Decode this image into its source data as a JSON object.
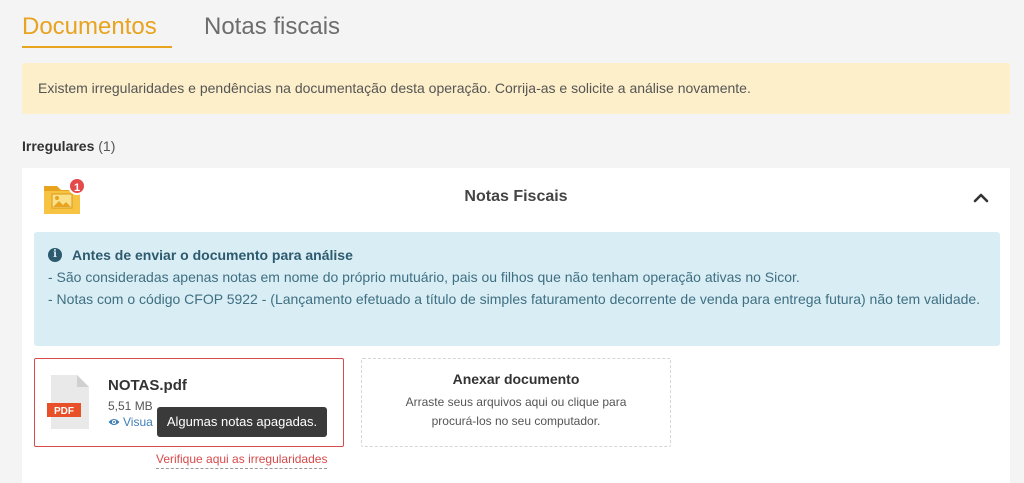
{
  "tabs": [
    {
      "label": "Documentos",
      "active": true
    },
    {
      "label": "Notas fiscais",
      "active": false
    }
  ],
  "warning": {
    "text": "Existem irregularidades e pendências na documentação desta operação. Corrija-as e solicite a análise novamente."
  },
  "section": {
    "title": "Irregulares",
    "count": "(1)"
  },
  "card": {
    "badge": "1",
    "title": "Notas Fiscais",
    "icons": {
      "folder": "folder-image-icon",
      "collapse": "chevron-up-icon"
    },
    "info": {
      "title": "Antes de enviar o documento para análise",
      "line1": "- São consideradas apenas notas em nome do próprio mutuário, pais ou filhos que não tenham operação ativas no Sicor.",
      "line2": "- Notas com o código CFOP 5922 - (Lançamento efetuado a título de simples faturamento decorrente de venda para entrega futura) não tem validade."
    },
    "file": {
      "name": "NOTAS.pdf",
      "size": "5,51 MB",
      "view_label": "Visua",
      "pdf_label": "PDF",
      "tooltip": "Algumas notas apagadas.",
      "irregular_link": "Verifique aqui as irregularidades"
    },
    "upload": {
      "title": "Anexar documento",
      "text": "Arraste seus arquivos aqui ou clique para procurá-los no seu computador."
    }
  },
  "colors": {
    "accent": "#e8a31f",
    "warning_bg": "#fdefc9",
    "info_bg": "#d9edf4",
    "error": "#d94a4a",
    "link": "#3f7fb8"
  }
}
